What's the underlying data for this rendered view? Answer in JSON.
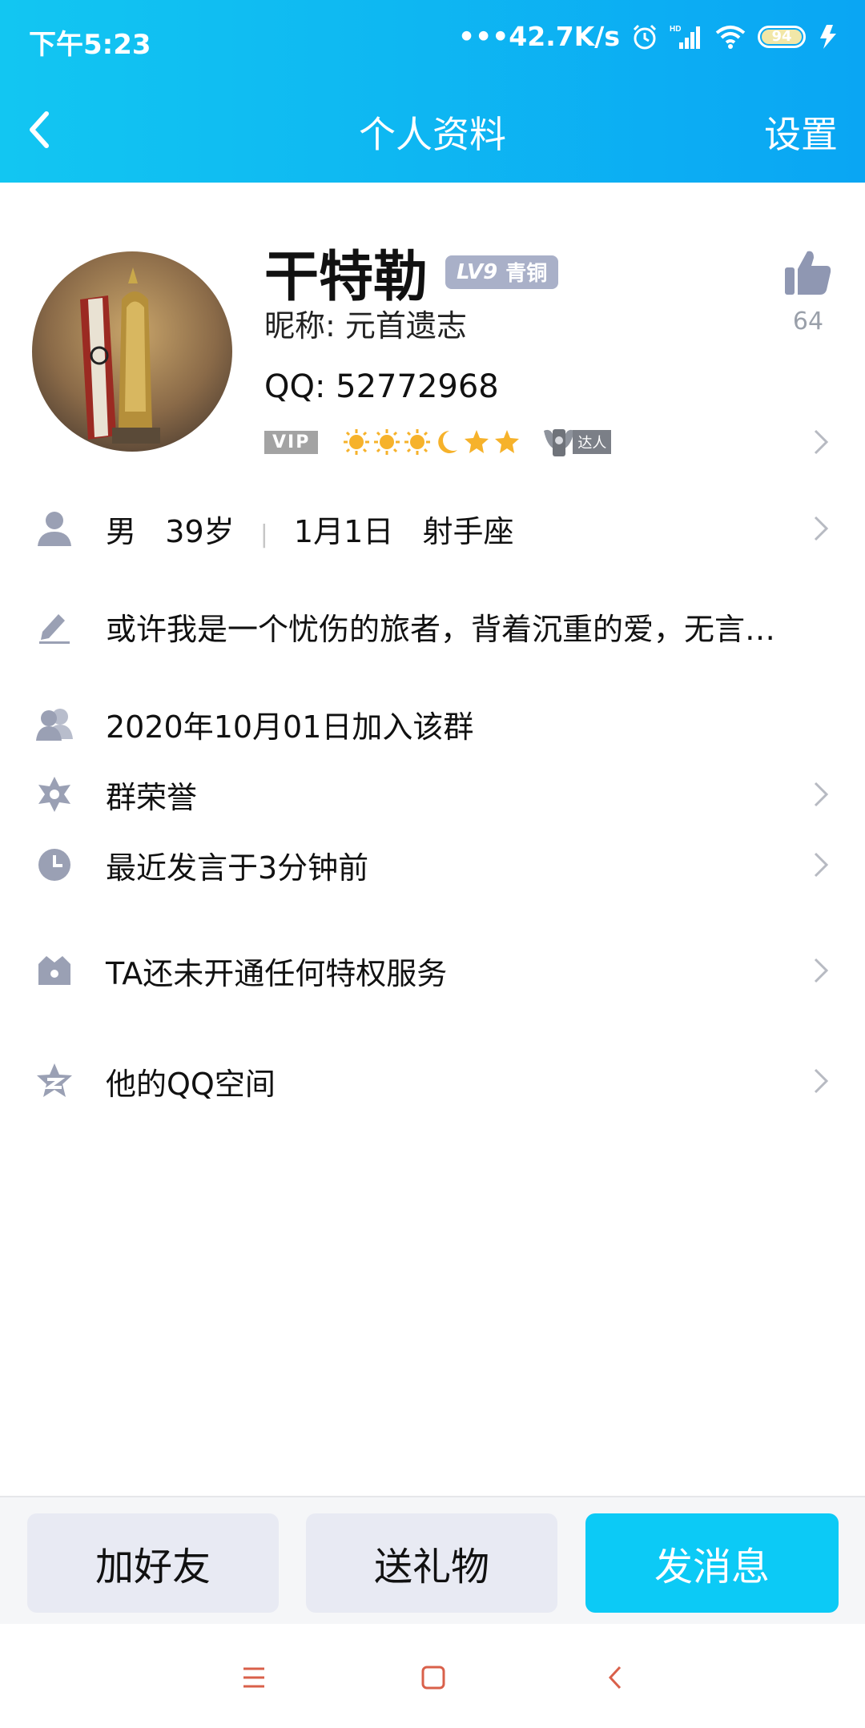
{
  "status_bar": {
    "time": "下午5:23",
    "network_speed": "•••42.7K/s",
    "battery": "94"
  },
  "nav": {
    "title": "个人资料",
    "settings_label": "设置"
  },
  "profile": {
    "name": "干特勒",
    "level_prefix": "LV9",
    "level_name": "青铜",
    "nickname": "昵称: 元首遗志",
    "qq": "QQ: 52772968",
    "vip_label": "VIP",
    "daren_label": "达人",
    "like_count": "64"
  },
  "rows": {
    "basic": {
      "gender": "男",
      "age": "39岁",
      "birthday": "1月1日",
      "zodiac": "射手座"
    },
    "signature": "或许我是一个忧伤的旅者，背着沉重的爱，无言…",
    "join_date": "2020年10月01日加入该群",
    "honor": "群荣誉",
    "last_speak": "最近发言于3分钟前",
    "privilege": "TA还未开通任何特权服务",
    "qzone": "他的QQ空间"
  },
  "actions": {
    "add_friend": "加好友",
    "send_gift": "送礼物",
    "send_message": "发消息"
  },
  "colors": {
    "header_start": "#12c6f2",
    "header_end": "#0aa6f3",
    "accent": "#0ccaf6",
    "icon_gray": "#9aa0b4"
  }
}
